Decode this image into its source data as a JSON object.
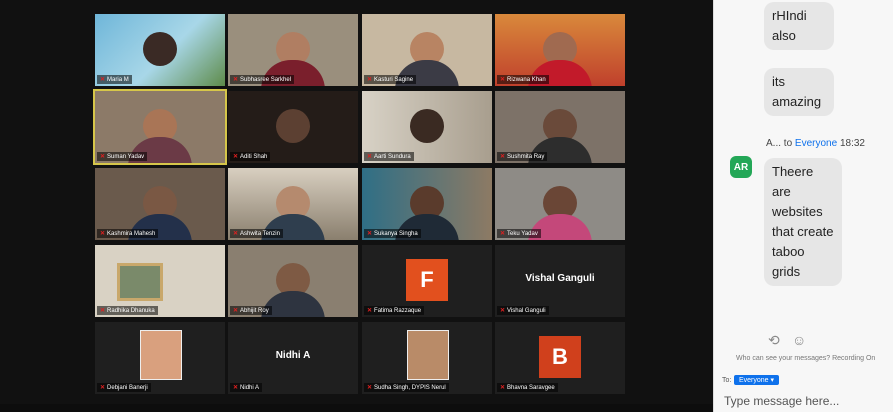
{
  "gallery": {
    "tiles": [
      {
        "name": "Maria M"
      },
      {
        "name": "Subhasree Sarkhel"
      },
      {
        "name": "Kasturi Sagine"
      },
      {
        "name": "Rizwana Khan"
      },
      {
        "name": "Suman Yadav"
      },
      {
        "name": "Aditi Shah"
      },
      {
        "name": "Aarti Sundura"
      },
      {
        "name": "Sushmita Ray"
      },
      {
        "name": "Kashmira Mahesh"
      },
      {
        "name": "Ashwita Tenzin"
      },
      {
        "name": "Sukanya Singha"
      },
      {
        "name": "Teku Yadav"
      },
      {
        "name": "Radhika Dhanuka"
      },
      {
        "name": "Abhijit Roy"
      },
      {
        "name": "Fatima Razzaque",
        "initial": "F"
      },
      {
        "name": "Vishal Ganguli",
        "display_name": "Vishal Ganguli"
      },
      {
        "name": "Debjani Banerji"
      },
      {
        "name": "Nidhi A",
        "display_name": "Nidhi A"
      },
      {
        "name": "Sudha Singh, DYPIS Nerul"
      },
      {
        "name": "Bhavna Saravgee",
        "initial": "B"
      }
    ]
  },
  "chat": {
    "messages": [
      {
        "text": "rHIndi also"
      },
      {
        "text": "its amazing"
      },
      {
        "text": "Theere are websites that create taboo grids"
      }
    ],
    "meta": {
      "sender": "A...",
      "to_word": "to",
      "to": "Everyone",
      "time": "18:32"
    },
    "avatar": "AR",
    "privacy_note": "Who can see your messages? Recording On",
    "to_label": "To:",
    "recipient": "Everyone",
    "input_placeholder": "Type message here..."
  }
}
